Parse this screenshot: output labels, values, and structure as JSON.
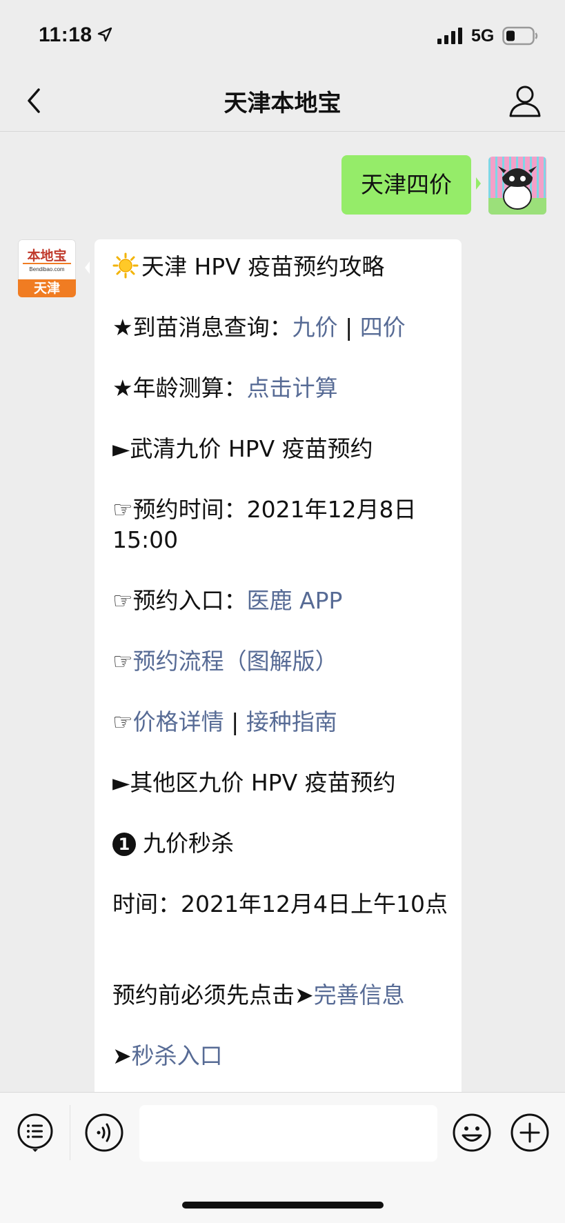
{
  "status_bar": {
    "time": "11:18",
    "network": "5G"
  },
  "nav": {
    "title": "天津本地宝"
  },
  "chat": {
    "outgoing": {
      "text": "天津四价"
    },
    "bot_avatar": {
      "top": "本地宝",
      "mid": "Bendibao.com",
      "bottom": "天津"
    },
    "message": {
      "title": "天津 HPV 疫苗预约攻略",
      "l2_prefix": "★到苗消息查询：",
      "l2_link1": "九价",
      "l2_sep": " | ",
      "l2_link2": "四价",
      "l3_prefix": "★年龄测算：",
      "l3_link": "点击计算",
      "l4": "►武清九价 HPV 疫苗预约",
      "l5": "☞预约时间：2021年12月8日 15:00",
      "l6_prefix": "☞预约入口：",
      "l6_link": "医鹿 APP",
      "l7_prefix": "☞",
      "l7_link": "预约流程（图解版）",
      "l8_prefix": "☞",
      "l8_link1": "价格详情",
      "l8_sep": " | ",
      "l8_link2": "接种指南",
      "l9": "►其他区九价 HPV 疫苗预约",
      "l10_num": "1",
      "l10_text": "九价秒杀",
      "l11": "时间：2021年12月4日上午10点",
      "l12_prefix": "预约前必须先点击➤",
      "l12_link": "完善信息",
      "l13_prefix": "➤",
      "l13_link": "秒杀入口"
    }
  },
  "input_bar": {
    "placeholder": ""
  },
  "colors": {
    "background": "#ededed",
    "outgoing_bubble": "#95ec69",
    "link": "#576b95",
    "brand_orange": "#f07c22"
  },
  "icons": [
    "location-arrow-icon",
    "signal-icon",
    "battery-icon",
    "back-chevron-icon",
    "person-icon",
    "list-menu-icon",
    "voice-icon",
    "emoji-icon",
    "plus-icon",
    "sun-icon"
  ]
}
